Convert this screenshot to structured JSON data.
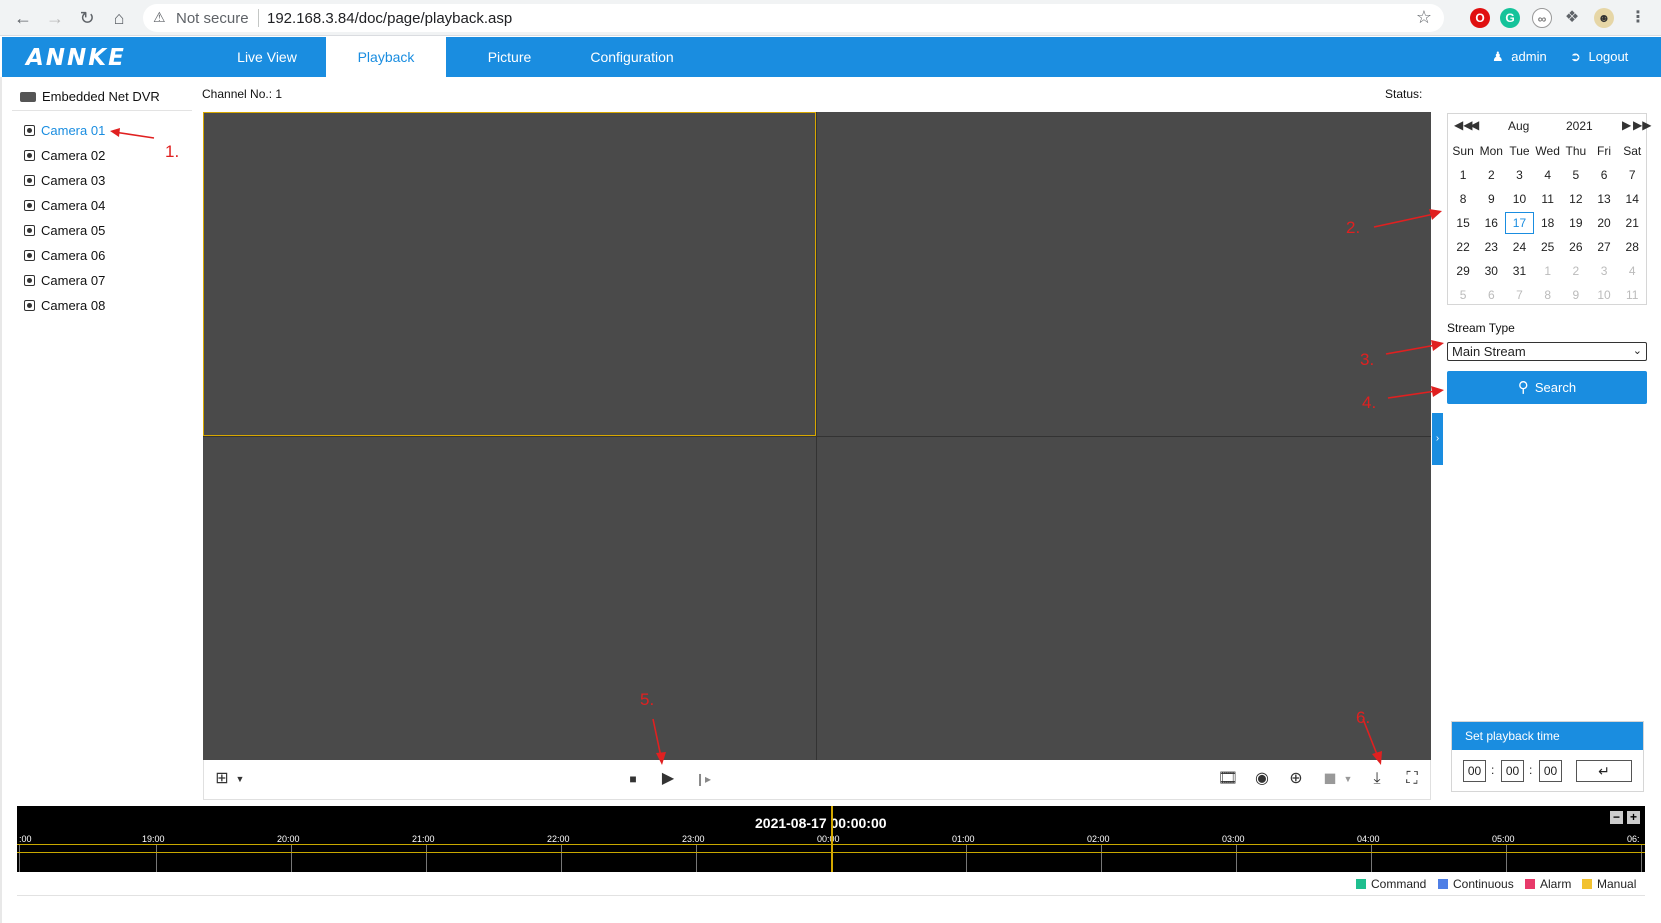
{
  "browser": {
    "security": "Not secure",
    "url": "192.168.3.84/doc/page/playback.asp"
  },
  "header": {
    "logo": "ANNKE",
    "tabs": [
      {
        "label": "Live View"
      },
      {
        "label": "Playback"
      },
      {
        "label": "Picture"
      },
      {
        "label": "Configuration"
      }
    ],
    "active_tab": "Playback",
    "user": "admin",
    "logout": "Logout",
    "accent_color": "#1a8de0"
  },
  "tree": {
    "root": "Embedded Net DVR",
    "cameras": [
      "Camera 01",
      "Camera 02",
      "Camera 03",
      "Camera 04",
      "Camera 05",
      "Camera 06",
      "Camera 07",
      "Camera 08"
    ],
    "selected": "Camera 01"
  },
  "info": {
    "channel": "Channel No.: 1",
    "status": "Status:"
  },
  "calendar": {
    "month": "Aug",
    "year": "2021",
    "weekdays": [
      "Sun",
      "Mon",
      "Tue",
      "Wed",
      "Thu",
      "Fri",
      "Sat"
    ],
    "weeks": [
      [
        "1",
        "2",
        "3",
        "4",
        "5",
        "6",
        "7"
      ],
      [
        "8",
        "9",
        "10",
        "11",
        "12",
        "13",
        "14"
      ],
      [
        "15",
        "16",
        "17",
        "18",
        "19",
        "20",
        "21"
      ],
      [
        "22",
        "23",
        "24",
        "25",
        "26",
        "27",
        "28"
      ],
      [
        "29",
        "30",
        "31",
        "1",
        "2",
        "3",
        "4"
      ],
      [
        "5",
        "6",
        "7",
        "8",
        "9",
        "10",
        "11"
      ]
    ],
    "selected_day": "17"
  },
  "stream": {
    "label": "Stream Type",
    "value": "Main Stream"
  },
  "search_label": "Search",
  "playback_time": {
    "title": "Set playback time",
    "hh": "00",
    "mm": "00",
    "ss": "00"
  },
  "timeline": {
    "current": "2021-08-17 00:00:00",
    "hours": [
      ":00",
      "19:00",
      "20:00",
      "21:00",
      "22:00",
      "23:00",
      "00:00",
      "01:00",
      "02:00",
      "03:00",
      "04:00",
      "05:00",
      "06:"
    ]
  },
  "legend": [
    {
      "label": "Command",
      "color": "#1fbf8f"
    },
    {
      "label": "Continuous",
      "color": "#4f7fe6"
    },
    {
      "label": "Alarm",
      "color": "#e83a6a"
    },
    {
      "label": "Manual",
      "color": "#f2c230"
    }
  ],
  "annotations": [
    "1.",
    "2.",
    "3.",
    "4.",
    "5.",
    "6."
  ]
}
